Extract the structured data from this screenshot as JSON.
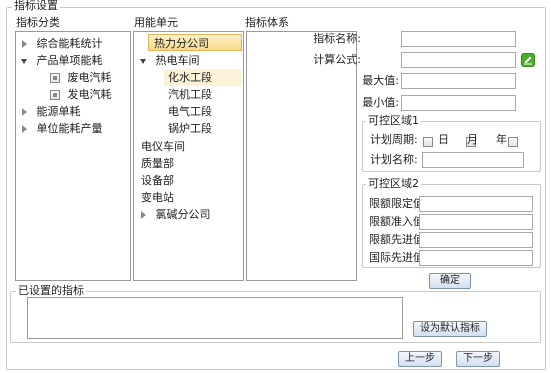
{
  "panel": {
    "title": "指标设置"
  },
  "columns": {
    "category_header": "指标分类",
    "unit_header": "用能单元",
    "system_header": "指标体系"
  },
  "category_tree": [
    {
      "label": "综合能耗统计"
    },
    {
      "label": "产品单项能耗"
    },
    {
      "label": "废电汽耗"
    },
    {
      "label": "发电汽耗"
    },
    {
      "label": "能源单耗"
    },
    {
      "label": "单位能耗产量"
    }
  ],
  "unit_tree": [
    {
      "label": "热力分公司"
    },
    {
      "label": "热电车间"
    },
    {
      "label": "化水工段"
    },
    {
      "label": "汽机工段"
    },
    {
      "label": "电气工段"
    },
    {
      "label": "锅炉工段"
    },
    {
      "label": "电仪车间"
    },
    {
      "label": "质量部"
    },
    {
      "label": "设备部"
    },
    {
      "label": "变电站"
    },
    {
      "label": "氯碱分公司"
    }
  ],
  "form": {
    "name_label": "指标名称:",
    "name_value": "",
    "formula_label": "计算公式:",
    "formula_value": "",
    "max_label": "最大值:",
    "max_value": "",
    "min_label": "最小值:",
    "min_value": ""
  },
  "control1": {
    "title": "可控区域1",
    "period_label": "计划周期:",
    "day_label": "日",
    "month_label": "月",
    "year_label": "年",
    "plan_name_label": "计划名称:",
    "plan_name_value": ""
  },
  "control2": {
    "title": "可控区域2",
    "limit_label": "限额限定值:",
    "limit_value": "",
    "entry_label": "限额准入值:",
    "entry_value": "",
    "advanced_label": "限额先进值:",
    "advanced_value": "",
    "intl_label": "国际先进值:",
    "intl_value": ""
  },
  "buttons": {
    "confirm": "确定",
    "set_default": "设为默认指标",
    "prev": "上一步",
    "next": "下一步"
  },
  "set_indicators": {
    "title": "已设置的指标",
    "content": ""
  },
  "colors": {
    "edit_icon": "#4caf2a",
    "highlight": "#f8d98a"
  }
}
